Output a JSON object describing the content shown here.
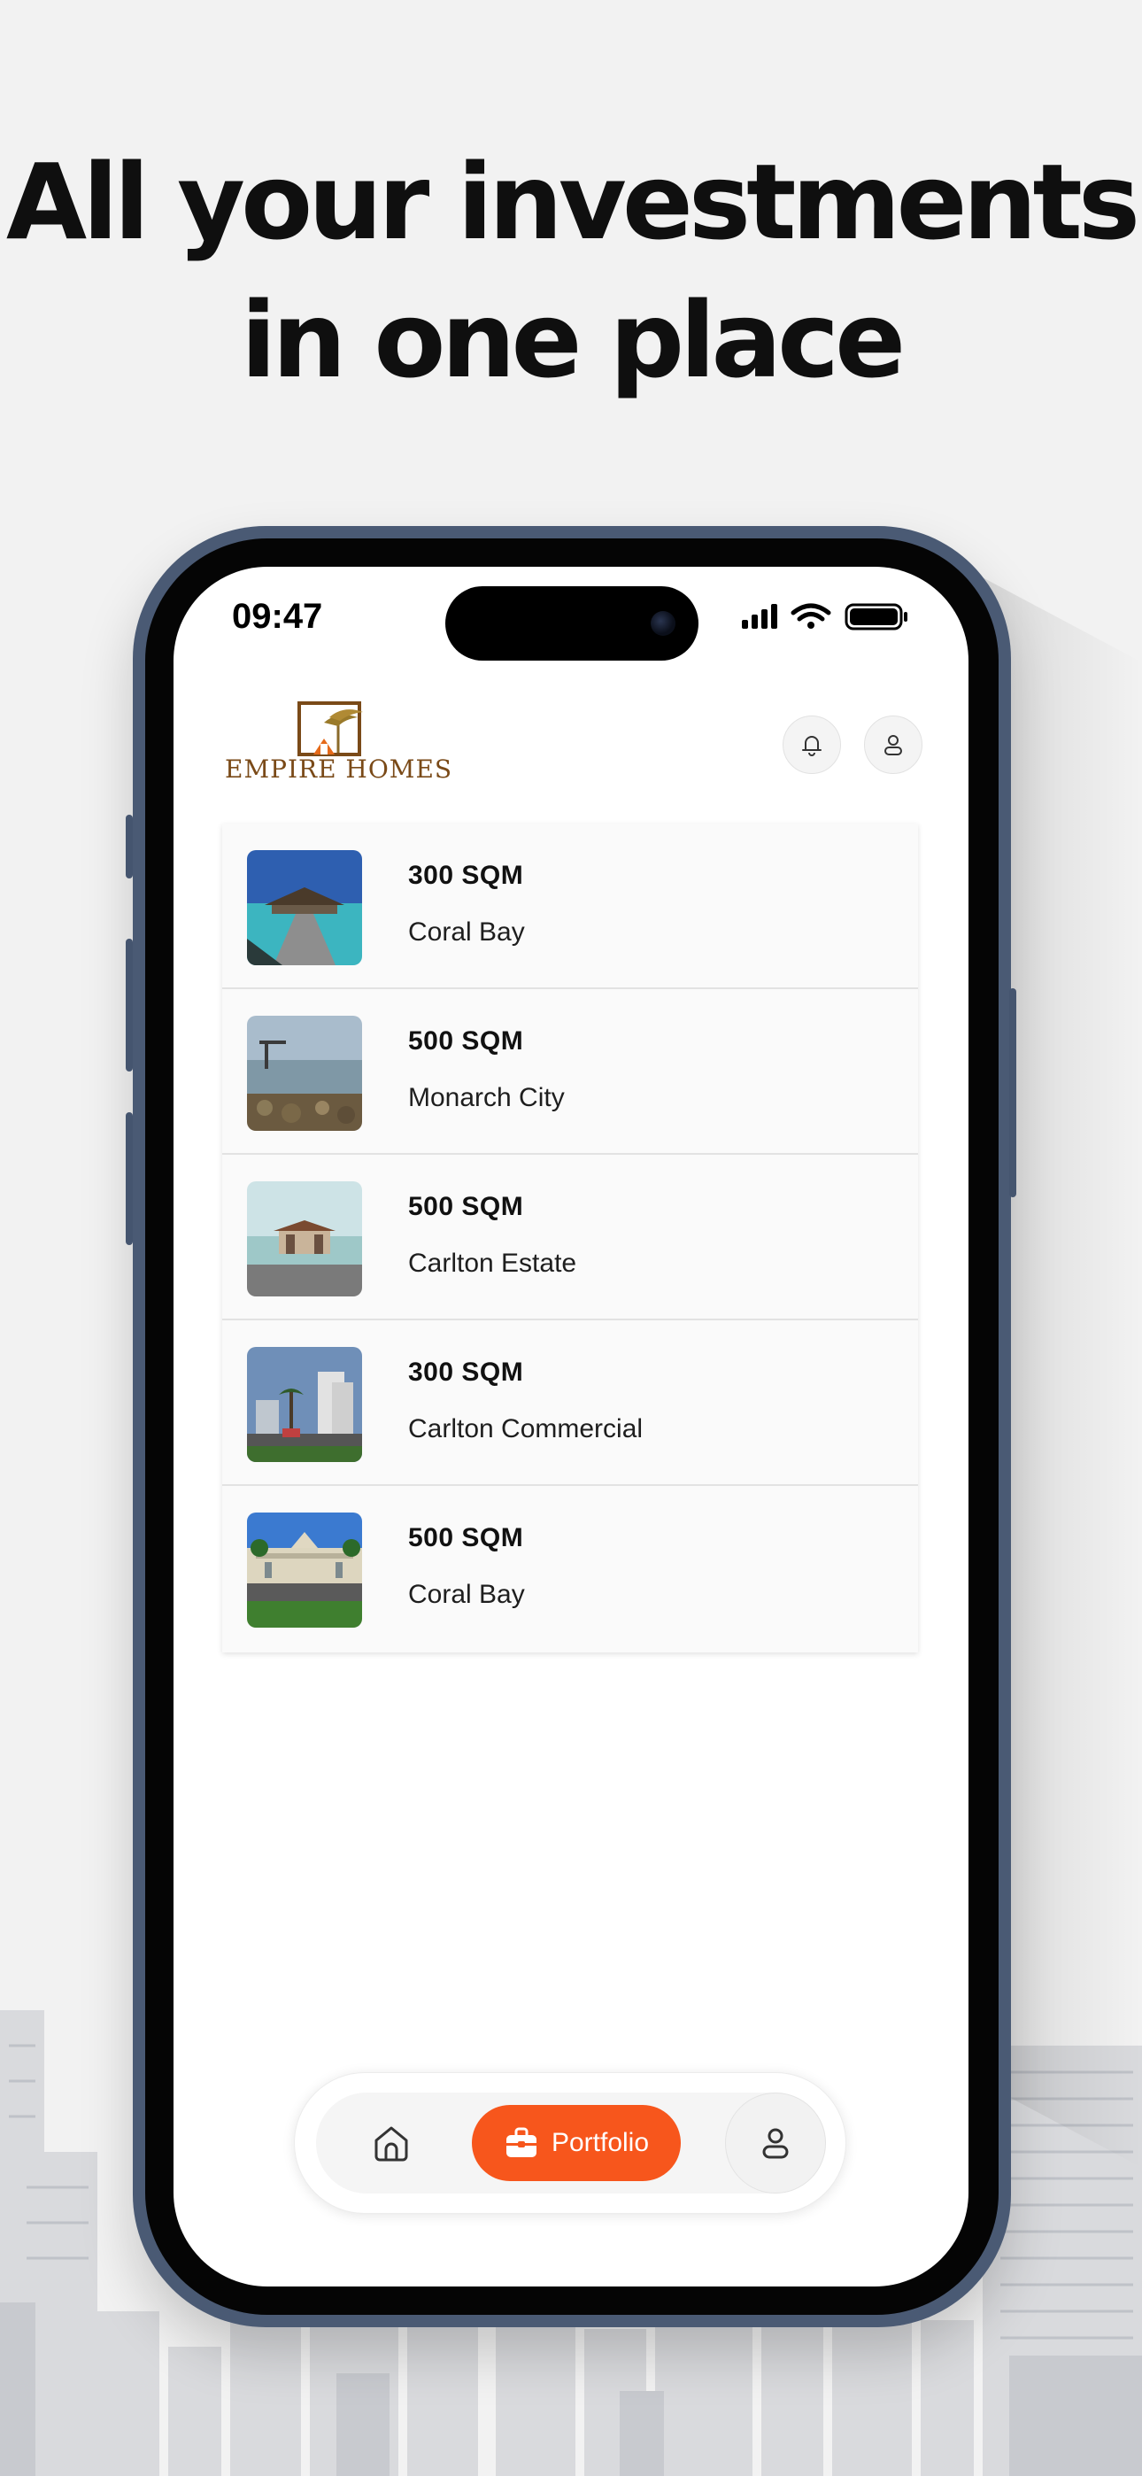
{
  "headline": {
    "line1": "All your investments",
    "line2": "in one place"
  },
  "status_bar": {
    "time": "09:47"
  },
  "brand": {
    "name": "Empire Homes",
    "logo_text": "EMPIRE HOMES"
  },
  "header": {
    "notifications_icon": "bell-icon",
    "account_icon": "user-icon"
  },
  "properties": [
    {
      "size": "300 SQM",
      "name": "Coral Bay"
    },
    {
      "size": "500 SQM",
      "name": "Monarch City"
    },
    {
      "size": "500 SQM",
      "name": "Carlton Estate"
    },
    {
      "size": "300 SQM",
      "name": "Carlton Commercial"
    },
    {
      "size": "500 SQM",
      "name": "Coral Bay"
    }
  ],
  "tab_bar": {
    "home_icon": "home-icon",
    "portfolio_label": "Portfolio",
    "portfolio_icon": "briefcase-icon",
    "profile_icon": "user-icon",
    "active_tab": "Portfolio"
  },
  "colors": {
    "accent": "#f7561c",
    "frame": "#4a5a74",
    "brand_brown": "#7a4a18"
  }
}
